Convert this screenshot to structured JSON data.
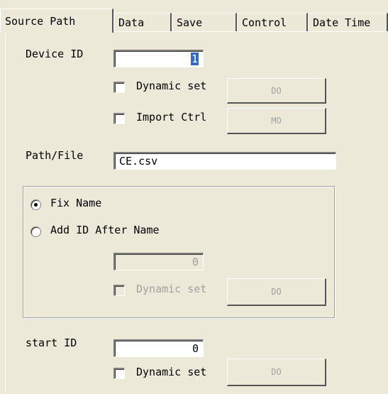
{
  "tabs": [
    {
      "label": "Source Path",
      "active": true
    },
    {
      "label": "Data",
      "active": false
    },
    {
      "label": "Save",
      "active": false
    },
    {
      "label": "Control",
      "active": false
    },
    {
      "label": "Date Time",
      "active": false
    }
  ],
  "device": {
    "label": "Device ID",
    "value": "1",
    "dynamic_set_label": "Dynamic set",
    "do_button": "DO",
    "import_ctrl_label": "Import Ctrl",
    "mo_button": "MO"
  },
  "path": {
    "label": "Path/File",
    "value": "CE.csv"
  },
  "name_mode": {
    "fix_name_label": "Fix Name",
    "add_id_label": "Add ID After Name",
    "id_value": "0",
    "dynamic_set_label": "Dynamic set",
    "do_button": "DO"
  },
  "start": {
    "label": "start ID",
    "value": "0",
    "dynamic_set_label": "Dynamic set",
    "do_button": "DO"
  }
}
